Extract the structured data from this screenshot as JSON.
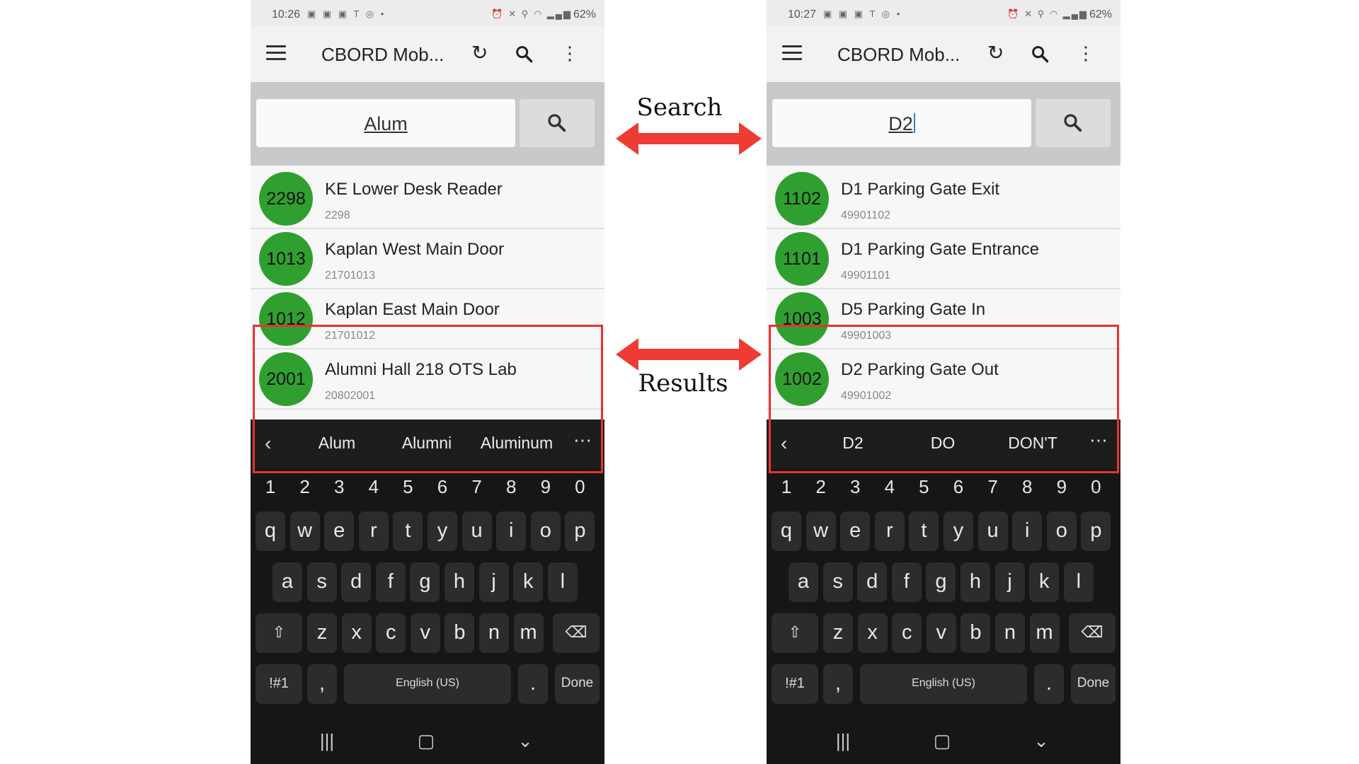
{
  "phones": [
    {
      "status": {
        "time": "10:26",
        "battery": "62%"
      },
      "app_title": "CBORD Mob...",
      "search_value": "Alum",
      "rows": [
        {
          "badge": "2298",
          "name": "KE Lower Desk Reader",
          "sub": "2298"
        },
        {
          "badge": "1013",
          "name": "Kaplan West Main Door",
          "sub": "21701013"
        },
        {
          "badge": "1012",
          "name": "Kaplan East Main Door",
          "sub": "21701012"
        },
        {
          "badge": "2001",
          "name": "Alumni Hall 218 OTS Lab",
          "sub": "20802001"
        }
      ],
      "suggestions": [
        "Alum",
        "Alumni",
        "Aluminum"
      ]
    },
    {
      "status": {
        "time": "10:27",
        "battery": "62%"
      },
      "app_title": "CBORD Mob...",
      "search_value": "D2",
      "rows": [
        {
          "badge": "1102",
          "name": "D1 Parking Gate Exit",
          "sub": "49901102"
        },
        {
          "badge": "1101",
          "name": "D1 Parking Gate Entrance",
          "sub": "49901101"
        },
        {
          "badge": "1003",
          "name": "D5 Parking Gate In",
          "sub": "49901003"
        },
        {
          "badge": "1002",
          "name": "D2 Parking Gate Out",
          "sub": "49901002"
        }
      ],
      "suggestions": [
        "D2",
        "DO",
        "DON'T"
      ]
    }
  ],
  "keyboard": {
    "numbers": [
      "1",
      "2",
      "3",
      "4",
      "5",
      "6",
      "7",
      "8",
      "9",
      "0"
    ],
    "row1": [
      "q",
      "w",
      "e",
      "r",
      "t",
      "y",
      "u",
      "i",
      "o",
      "p"
    ],
    "row2": [
      "a",
      "s",
      "d",
      "f",
      "g",
      "h",
      "j",
      "k",
      "l"
    ],
    "row3": [
      "z",
      "x",
      "c",
      "v",
      "b",
      "n",
      "m"
    ],
    "symbols": "!#1",
    "comma": ",",
    "space": "English (US)",
    "period": ".",
    "done": "Done"
  },
  "annotations": {
    "search": "Search",
    "results": "Results"
  },
  "colors": {
    "badge": "#2fa02f",
    "highlight": "#e83232",
    "arrow": "#ee3b33"
  },
  "icons": {
    "menu": "hamburger-icon",
    "refresh": "refresh-icon",
    "search": "search-icon",
    "more": "more-vert-icon",
    "shift": "shift-icon",
    "backspace": "backspace-icon"
  }
}
